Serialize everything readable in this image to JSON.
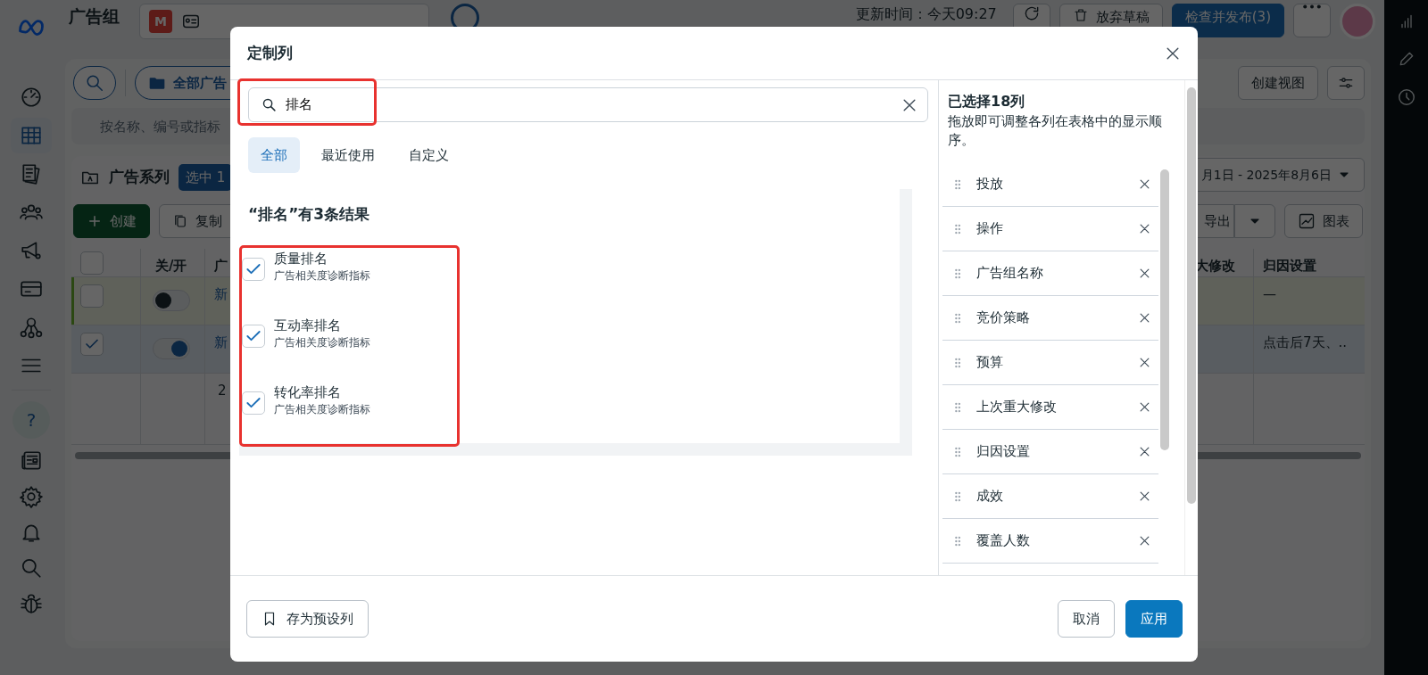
{
  "sidebar": {
    "items": [
      {
        "kind": "gauge",
        "selected": false
      },
      {
        "kind": "table",
        "selected": true
      },
      {
        "kind": "pages",
        "selected": false
      },
      {
        "kind": "people",
        "selected": false
      },
      {
        "kind": "megaphone",
        "selected": false
      },
      {
        "kind": "card",
        "selected": false
      },
      {
        "kind": "hierarchy",
        "selected": false
      },
      {
        "kind": "menu",
        "selected": false
      }
    ],
    "help": "?",
    "bottom_items": [
      {
        "kind": "news"
      },
      {
        "kind": "gear"
      },
      {
        "kind": "bell"
      },
      {
        "kind": "search"
      },
      {
        "kind": "bug"
      }
    ]
  },
  "topbar": {
    "title": "广告组",
    "account_initial": "M",
    "updated": "更新时间：今天09:27",
    "discard": "放弃草稿",
    "publish": "检查并发布(3)"
  },
  "views": {
    "all_ads": "全部广告",
    "create_view": "创建视图"
  },
  "filter": {
    "placeholder": "按名称、编号或指标"
  },
  "campaigns": {
    "label": "广告系列",
    "badge": "选中 1",
    "date_range": "月1日 - 2025年8月6日"
  },
  "actions": {
    "create": "创建",
    "copy": "复制",
    "export": "导出",
    "chart": "图表"
  },
  "table": {
    "header_checked": false,
    "columns_left": [
      "关/开",
      "广"
    ],
    "columns_right": [
      "大修改",
      "归因设置"
    ],
    "rows": [
      {
        "kind": "item",
        "edited": true,
        "selected": false,
        "on": false,
        "name": "新",
        "attribution": "—"
      },
      {
        "kind": "item",
        "edited": false,
        "selected": true,
        "on": true,
        "name": "新",
        "attribution": "点击后7天、.."
      },
      {
        "kind": "summary",
        "name": "2"
      }
    ]
  },
  "modal": {
    "title": "定制列",
    "search": {
      "value": "排名"
    },
    "tabs": [
      {
        "label": "全部",
        "selected": true
      },
      {
        "label": "最近使用",
        "selected": false
      },
      {
        "label": "自定义",
        "selected": false
      }
    ],
    "results": {
      "heading": "“排名”有3条结果",
      "items": [
        {
          "title": "质量排名",
          "subtitle": "广告相关度诊断指标",
          "checked": true
        },
        {
          "title": "互动率排名",
          "subtitle": "广告相关度诊断指标",
          "checked": true
        },
        {
          "title": "转化率排名",
          "subtitle": "广告相关度诊断指标",
          "checked": true
        }
      ]
    },
    "selected_panel": {
      "heading": "已选择18列",
      "hint": "拖放即可调整各列在表格中的显示顺序。",
      "items": [
        "投放",
        "操作",
        "广告组名称",
        "竞价策略",
        "预算",
        "上次重大修改",
        "归因设置",
        "成效",
        "覆盖人数"
      ]
    },
    "footer": {
      "save_preset": "存为预设列",
      "cancel": "取消",
      "apply": "应用"
    }
  }
}
